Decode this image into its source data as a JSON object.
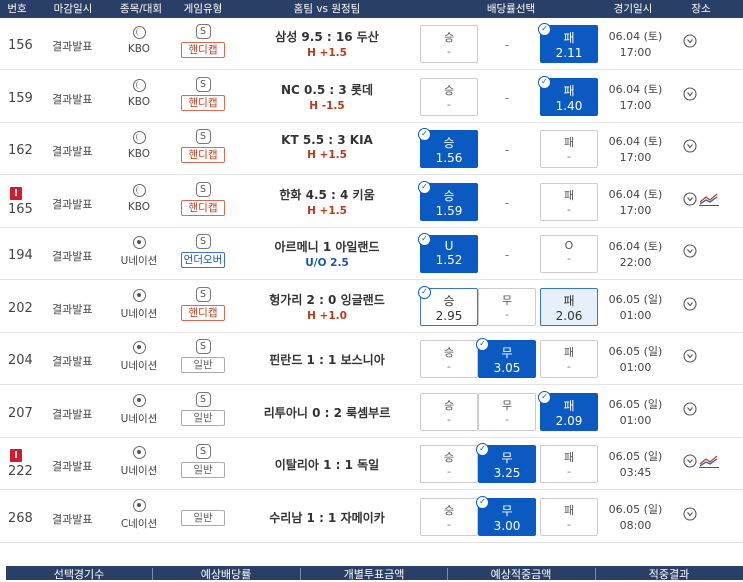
{
  "header": {
    "no": "번호",
    "deadline": "마감일시",
    "sport": "종목/대회",
    "game_type": "게임유형",
    "teams": "홈팀 vs 원정팀",
    "odds": "배당률선택",
    "date": "경기일시",
    "place": "장소"
  },
  "rows": [
    {
      "no": "156",
      "status": "결과발표",
      "sport": "KBO",
      "ball": "baseball",
      "tag": "핸디캡",
      "tag_kind": "handi",
      "teams": "삼성 9.5 : 16 두산",
      "line": "H +1.5",
      "line_kind": "handi",
      "odds": [
        {
          "label": "승",
          "value": "-",
          "state": "plain"
        },
        null,
        {
          "label": "패",
          "value": "2.11",
          "state": "sel"
        }
      ],
      "middle_dash": "-",
      "date": "06.04 (토)",
      "time": "17:00",
      "alert": false,
      "trend": false
    },
    {
      "no": "159",
      "status": "결과발표",
      "sport": "KBO",
      "ball": "baseball",
      "tag": "핸디캡",
      "tag_kind": "handi",
      "teams": "NC 0.5 : 3 롯데",
      "line": "H -1.5",
      "line_kind": "handi",
      "odds": [
        {
          "label": "승",
          "value": "-",
          "state": "plain"
        },
        null,
        {
          "label": "패",
          "value": "1.40",
          "state": "sel"
        }
      ],
      "middle_dash": "-",
      "date": "06.04 (토)",
      "time": "17:00",
      "alert": false,
      "trend": false
    },
    {
      "no": "162",
      "status": "결과발표",
      "sport": "KBO",
      "ball": "baseball",
      "tag": "핸디캡",
      "tag_kind": "handi",
      "teams": "KT 5.5 : 3 KIA",
      "line": "H +1.5",
      "line_kind": "handi",
      "odds": [
        {
          "label": "승",
          "value": "1.56",
          "state": "sel"
        },
        null,
        {
          "label": "패",
          "value": "-",
          "state": "plain"
        }
      ],
      "middle_dash": "-",
      "date": "06.04 (토)",
      "time": "17:00",
      "alert": false,
      "trend": false
    },
    {
      "no": "165",
      "status": "결과발표",
      "sport": "KBO",
      "ball": "baseball",
      "tag": "핸디캡",
      "tag_kind": "handi",
      "teams": "한화 4.5 : 4 키움",
      "line": "H +1.5",
      "line_kind": "handi",
      "odds": [
        {
          "label": "승",
          "value": "1.59",
          "state": "sel"
        },
        null,
        {
          "label": "패",
          "value": "-",
          "state": "plain"
        }
      ],
      "middle_dash": "-",
      "date": "06.04 (토)",
      "time": "17:00",
      "alert": true,
      "trend": true
    },
    {
      "no": "194",
      "status": "결과발표",
      "sport": "U네이션",
      "ball": "soccer",
      "tag": "언더오버",
      "tag_kind": "uo",
      "teams": "아르메니 1 아일랜드",
      "line": "U/O 2.5",
      "line_kind": "uo",
      "odds": [
        {
          "label": "U",
          "value": "1.52",
          "state": "sel"
        },
        null,
        {
          "label": "O",
          "value": "-",
          "state": "plain"
        }
      ],
      "middle_dash": "-",
      "date": "06.04 (토)",
      "time": "22:00",
      "alert": false,
      "trend": false
    },
    {
      "no": "202",
      "status": "결과발표",
      "sport": "U네이션",
      "ball": "soccer",
      "tag": "핸디캡",
      "tag_kind": "handi",
      "teams": "헝가리 2 : 0 잉글랜드",
      "line": "H +1.0",
      "line_kind": "handi",
      "odds": [
        {
          "label": "승",
          "value": "2.95",
          "state": "outline"
        },
        {
          "label": "무",
          "value": "-",
          "state": "plain"
        },
        {
          "label": "패",
          "value": "2.06",
          "state": "light"
        }
      ],
      "middle_dash": "",
      "date": "06.05 (일)",
      "time": "01:00",
      "alert": false,
      "trend": false
    },
    {
      "no": "204",
      "status": "결과발표",
      "sport": "U네이션",
      "ball": "soccer",
      "tag": "일반",
      "tag_kind": "normal",
      "teams": "핀란드 1 : 1 보스니아",
      "line": "",
      "line_kind": "",
      "odds": [
        {
          "label": "승",
          "value": "-",
          "state": "plain"
        },
        {
          "label": "무",
          "value": "3.05",
          "state": "sel"
        },
        {
          "label": "패",
          "value": "-",
          "state": "plain"
        }
      ],
      "middle_dash": "",
      "date": "06.05 (일)",
      "time": "01:00",
      "alert": false,
      "trend": false
    },
    {
      "no": "207",
      "status": "결과발표",
      "sport": "U네이션",
      "ball": "soccer",
      "tag": "일반",
      "tag_kind": "normal",
      "teams": "리투아니 0 : 2 룩셈부르",
      "line": "",
      "line_kind": "",
      "odds": [
        {
          "label": "승",
          "value": "-",
          "state": "plain"
        },
        {
          "label": "무",
          "value": "-",
          "state": "plain"
        },
        {
          "label": "패",
          "value": "2.09",
          "state": "sel"
        }
      ],
      "middle_dash": "",
      "date": "06.05 (일)",
      "time": "01:00",
      "alert": false,
      "trend": false
    },
    {
      "no": "222",
      "status": "결과발표",
      "sport": "U네이션",
      "ball": "soccer",
      "tag": "일반",
      "tag_kind": "normal",
      "teams": "이탈리아 1 : 1 독일",
      "line": "",
      "line_kind": "",
      "odds": [
        {
          "label": "승",
          "value": "-",
          "state": "plain"
        },
        {
          "label": "무",
          "value": "3.25",
          "state": "sel"
        },
        {
          "label": "패",
          "value": "-",
          "state": "plain"
        }
      ],
      "middle_dash": "",
      "date": "06.05 (일)",
      "time": "03:45",
      "alert": true,
      "trend": true
    },
    {
      "no": "268",
      "status": "결과발표",
      "sport": "C네이션",
      "ball": "soccer",
      "tag": "일반",
      "tag_kind": "normal",
      "teams": "수리남 1 : 1 자메이카",
      "line": "",
      "line_kind": "",
      "odds": [
        {
          "label": "승",
          "value": "-",
          "state": "plain"
        },
        {
          "label": "무",
          "value": "3.00",
          "state": "sel"
        },
        {
          "label": "패",
          "value": "-",
          "state": "plain"
        }
      ],
      "middle_dash": "",
      "date": "06.05 (일)",
      "time": "08:00",
      "alert": false,
      "trend": false,
      "no_s_icon": true
    }
  ],
  "s_icon_text": "S",
  "check_glyph": "✓",
  "alert_glyph": "!",
  "footer": {
    "selected_count": "선택경기수",
    "expected_odds": "예상배당률",
    "bet_amount": "개별투표금액",
    "expected_payout": "예상적중금액",
    "result": "적중결과"
  },
  "colors": {
    "header_bg": "#2a3f66",
    "selected": "#0a5ac2",
    "handicap": "#c0391b",
    "under_over": "#1a56b0",
    "alert": "#cc1e2f"
  }
}
